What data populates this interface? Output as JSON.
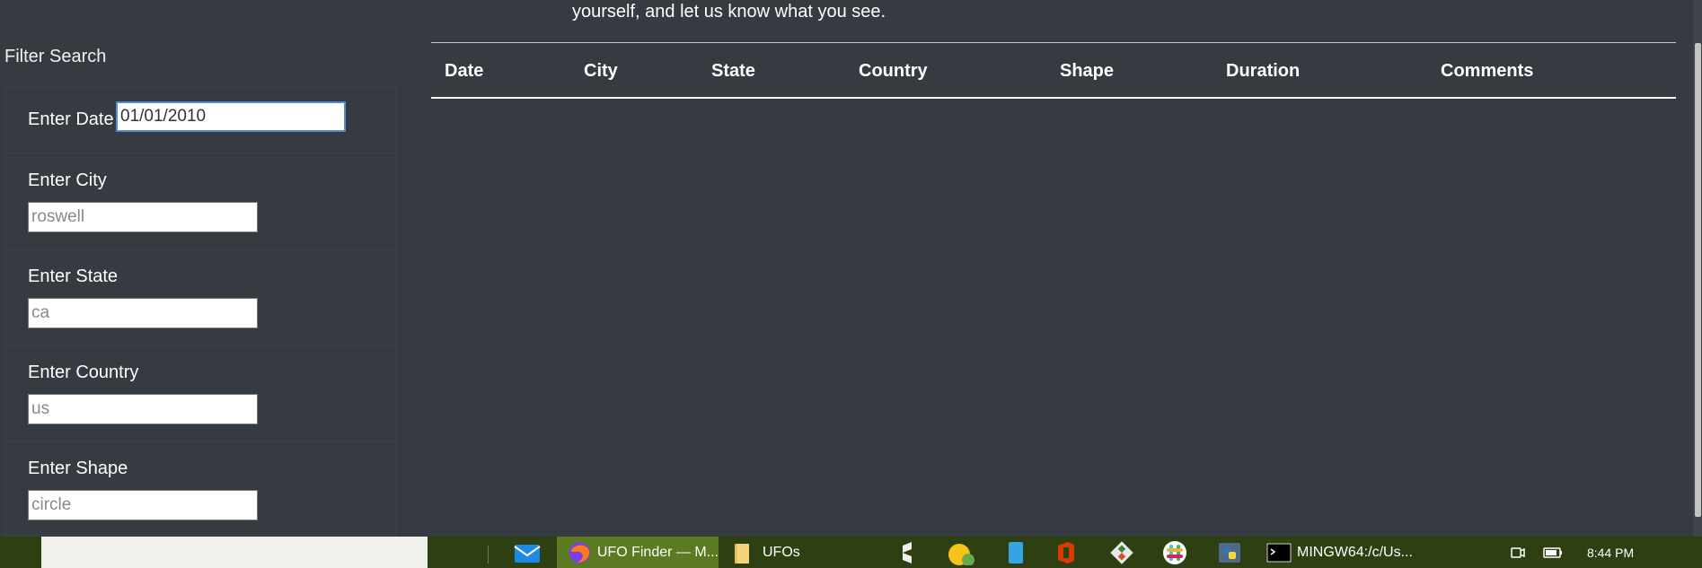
{
  "intro": {
    "text": "yourself, and let us know what you see."
  },
  "filters": {
    "title": "Filter Search",
    "date": {
      "label": "Enter Date",
      "value": "01/01/2010"
    },
    "city": {
      "label": "Enter City",
      "placeholder": "roswell"
    },
    "state": {
      "label": "Enter State",
      "placeholder": "ca"
    },
    "country": {
      "label": "Enter Country",
      "placeholder": "us"
    },
    "shape": {
      "label": "Enter Shape",
      "placeholder": "circle"
    }
  },
  "table": {
    "columns": [
      "Date",
      "City",
      "State",
      "Country",
      "Shape",
      "Duration",
      "Comments"
    ]
  },
  "taskbar": {
    "firefox_label": "UFO Finder — M...",
    "folder_label": "UFOs",
    "terminal_label": "MINGW64:/c/Us...",
    "clock": "8:44 PM",
    "icons": {
      "mail": "mail-icon",
      "firefox": "firefox-icon",
      "folder": "folder-icon",
      "sublime": "sublime-icon",
      "chrome-canary": "chrome-canary-icon",
      "phone": "phone-icon",
      "office": "office-icon",
      "git": "git-icon",
      "slack": "slack-icon",
      "python": "python-icon",
      "terminal": "terminal-icon",
      "meet-now": "meet-now-icon",
      "battery": "battery-icon"
    },
    "colors": {
      "bar": "#2e3f12",
      "active": "#5b7a21"
    }
  },
  "colors": {
    "background": "#363a41",
    "focus_border": "#4a90d9"
  }
}
